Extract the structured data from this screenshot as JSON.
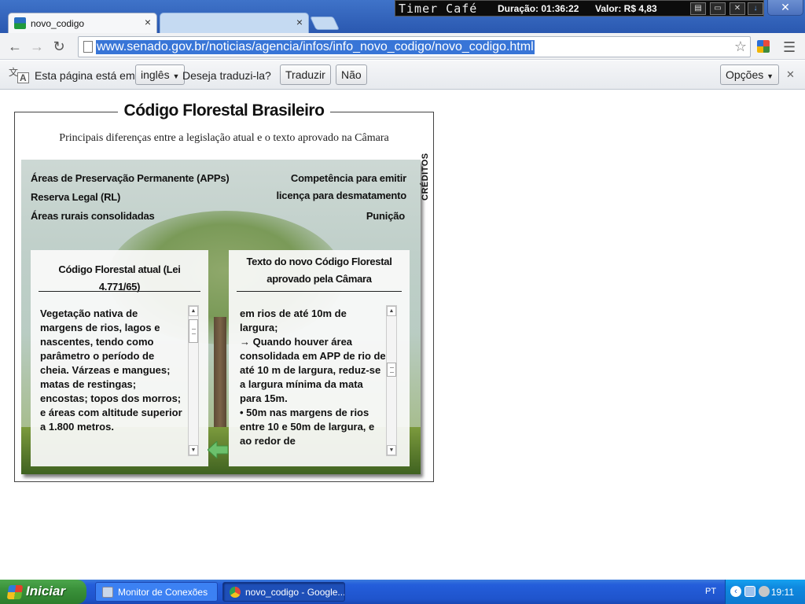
{
  "timer_bar": {
    "brand": "Timer Café",
    "duration": "Duração: 01:36:22",
    "value": "Valor: R$ 4,83"
  },
  "tabs": [
    {
      "title": "novo_codigo",
      "active": true
    },
    {
      "title": "",
      "active": false
    }
  ],
  "toolbar": {
    "url": "www.senado.gov.br/noticias/agencia/infos/info_novo_codigo/novo_codigo.html"
  },
  "translate_bar": {
    "prefix": "Esta página está em",
    "language": "inglês",
    "question": "Deseja traduzi-la?",
    "translate_label": "Traduzir",
    "no_label": "Não",
    "options_label": "Opções"
  },
  "infographic": {
    "title": "Código Florestal Brasileiro",
    "subtitle": "Principais diferenças entre a legislação atual e o texto aprovado na Câmara",
    "menu_left": [
      "Áreas de Preservação Permanente (APPs)",
      "Reserva Legal (RL)",
      "Áreas rurais consolidadas"
    ],
    "menu_right": [
      "Competência para emitir",
      "licença para desmatamento",
      "Punição"
    ],
    "credits": "CRÉDITOS",
    "panel_left": {
      "header": "Código Florestal atual (Lei 4.771/65)",
      "text": "Vegetação nativa de margens de rios, lagos e nascentes, tendo como parâmetro o período de cheia. Várzeas e mangues; matas de restingas; encostas; topos dos morros; e áreas com altitude superior a 1.800 metros."
    },
    "panel_right": {
      "header_line1": "Texto do novo Código Florestal",
      "header_line2": "aprovado pela Câmara",
      "text": "em rios de até 10m de largura;\n→ Quando houver área consolidada em APP de rio de até 10 m de largura, reduz-se a largura mínima da mata para 15m.\n• 50m nas margens de rios entre 10 e 50m de largura, e ao redor de"
    }
  },
  "taskbar": {
    "start_label": "Iniciar",
    "items": [
      "Monitor de Conexões",
      "novo_codigo - Google..."
    ],
    "language": "PT",
    "clock": "19:11"
  }
}
